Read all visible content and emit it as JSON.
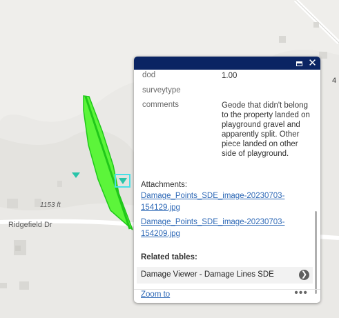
{
  "map": {
    "road_label": "Ridgefield Dr",
    "elevation_label": "1153 ft",
    "edge_number": "4",
    "feature_color": "#5cf53a",
    "feature_stroke": "#20c81a",
    "selection_color": "#46e0e6",
    "point_color": "#29c4a9"
  },
  "popup": {
    "header_color": "#0a2463",
    "fields": [
      {
        "name": "dod",
        "value": "1.00"
      },
      {
        "name": "surveytype",
        "value": ""
      },
      {
        "name": "comments",
        "value": "Geode that didn't belong to the property landed on playground gravel and apparently split. Other piece landed on other side of playground."
      }
    ],
    "attachments_label": "Attachments:",
    "attachments": [
      "Damage_Points_SDE_image-20230703-154129.jpg",
      "Damage_Points_SDE_image-20230703-154209.jpg"
    ],
    "related_label": "Related tables:",
    "related_item": "Damage Viewer - Damage Lines SDE",
    "zoom_label": "Zoom to",
    "more_label": "•••",
    "close_glyph": "✕"
  }
}
